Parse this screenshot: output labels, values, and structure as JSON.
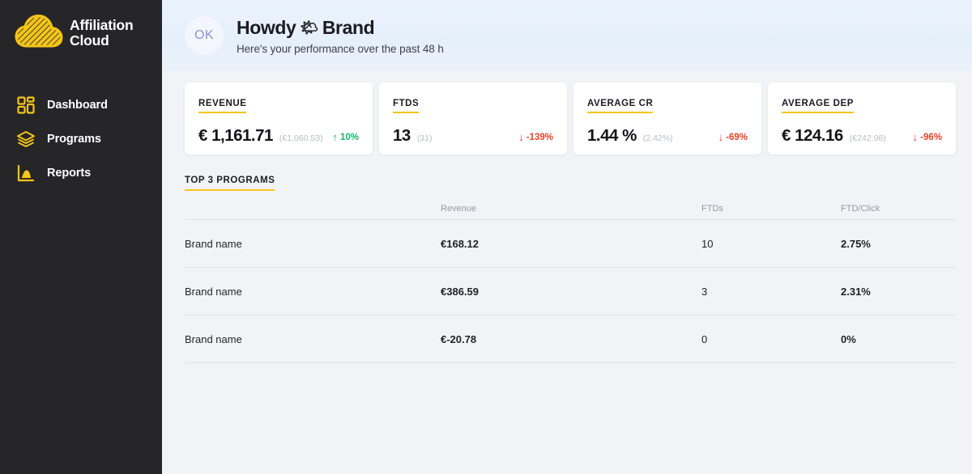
{
  "sidebar": {
    "brand": {
      "line1": "Affiliation",
      "line2": "Cloud",
      "logo_icon": "cloud-icon",
      "logo_color": "#f5c518"
    },
    "items": [
      {
        "label": "Dashboard",
        "icon": "grid-icon"
      },
      {
        "label": "Programs",
        "icon": "layers-icon"
      },
      {
        "label": "Reports",
        "icon": "chart-icon"
      }
    ]
  },
  "header": {
    "avatar_initials": "OK",
    "title_prefix": "Howdy",
    "title_emoji": "🌤",
    "title_name": "Brand",
    "subtitle": "Here's your performance over the past 48 h"
  },
  "cards": [
    {
      "title": "REVENUE",
      "value": "€ 1,161.71",
      "comparison": "(€1,060.53)",
      "delta": "10%",
      "delta_direction": "up",
      "delta_arrow": "↑",
      "delta_color": "#12b76a"
    },
    {
      "title": "FTDS",
      "value": "13",
      "comparison": "(31)",
      "delta": "-139%",
      "delta_direction": "down",
      "delta_arrow": "↓",
      "delta_color": "#e8402a"
    },
    {
      "title": "AVERAGE CR",
      "value": "1.44 %",
      "comparison": "(2.42%)",
      "delta": "-69%",
      "delta_direction": "down",
      "delta_arrow": "↓",
      "delta_color": "#e8402a"
    },
    {
      "title": "AVERAGE DEP",
      "value": "€ 124.16",
      "comparison": "(€242.98)",
      "delta": "-96%",
      "delta_direction": "down",
      "delta_arrow": "↓",
      "delta_color": "#e8402a"
    }
  ],
  "table": {
    "title": "TOP 3 PROGRAMS",
    "columns": [
      "",
      "Revenue",
      "FTDs",
      "FTD/Click"
    ],
    "rows": [
      {
        "name": "Brand name",
        "revenue": "€168.12",
        "ftds": "10",
        "ftd_click": "2.75%"
      },
      {
        "name": "Brand name",
        "revenue": "€386.59",
        "ftds": "3",
        "ftd_click": "2.31%"
      },
      {
        "name": "Brand name",
        "revenue": "€-20.78",
        "ftds": "0",
        "ftd_click": "0%"
      }
    ]
  },
  "theme": {
    "accent": "#f5c518",
    "sidebar_bg": "#262629",
    "header_bg": "#e8f1fb",
    "content_bg": "#f2f3f7",
    "positive": "#12b76a",
    "negative": "#e8402a"
  }
}
